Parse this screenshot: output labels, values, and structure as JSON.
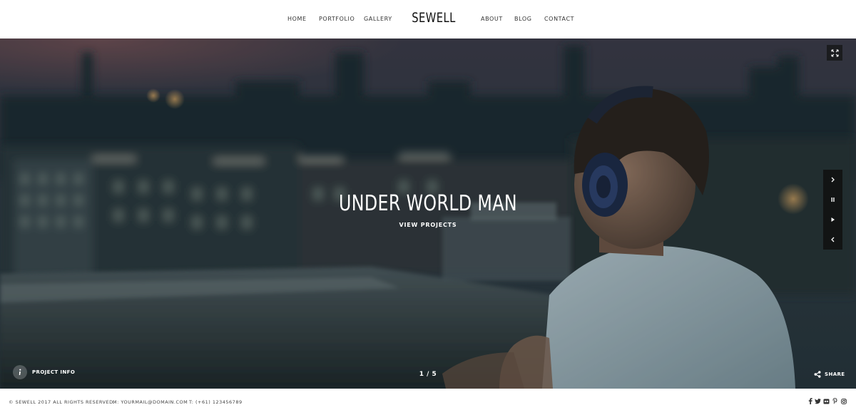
{
  "header": {
    "nav_left": [
      "HOME",
      "PORTFOLIO",
      "GALLERY"
    ],
    "logo": "SEWELL",
    "nav_right": [
      "ABOUT",
      "BLOG",
      "CONTACT"
    ]
  },
  "hero": {
    "title": "UNDER WORLD MAN",
    "link": "VIEW PROJECTS",
    "project_info_label": "PROJECT INFO",
    "counter": "1 / 5",
    "share_label": "SHARE",
    "icons": {
      "fullscreen": "fullscreen-icon",
      "next": "chevron-right-icon",
      "pause": "pause-icon",
      "play": "play-icon",
      "prev": "chevron-left-icon",
      "info": "info-icon",
      "share": "share-icon"
    }
  },
  "footer": {
    "copyright": "© SEWELL 2017 ALL RIGHTS RESERVED.",
    "email": "M: YOURMAIL@DOMAIN.COM",
    "phone": "T: (+61) 123456789",
    "social": [
      "facebook-icon",
      "twitter-icon",
      "flickr-icon",
      "pinterest-icon",
      "instagram-icon"
    ]
  },
  "colors": {
    "header_bg": "#ffffff",
    "text_dark": "#222222",
    "overlay_text": "#ffffff",
    "control_bg": "#141414"
  }
}
